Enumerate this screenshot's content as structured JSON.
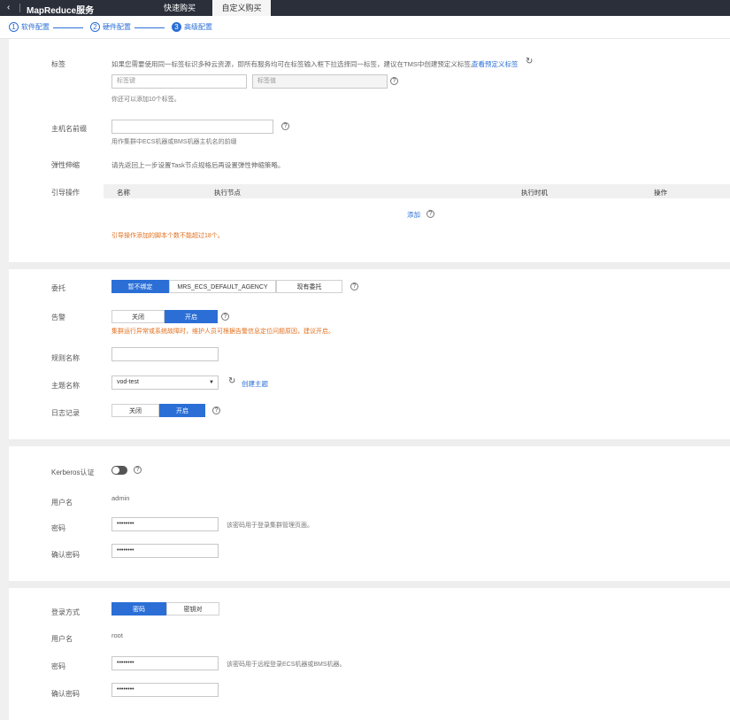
{
  "header": {
    "title": "MapReduce服务",
    "tabs": [
      "快速购买",
      "自定义购买"
    ]
  },
  "steps": [
    {
      "num": "1",
      "label": "软件配置"
    },
    {
      "num": "2",
      "label": "硬件配置"
    },
    {
      "num": "3",
      "label": "高级配置"
    }
  ],
  "tags": {
    "label": "标签",
    "hint": "如果您需要使用同一标签标识多种云资源，即所有服务均可在标签输入框下拉选择同一标签，建议在TMS中创建预定义标签。",
    "link": "查看预定义标签",
    "key_placeholder": "标签键",
    "value_placeholder": "标签值",
    "remaining": "你还可以添加10个标签。"
  },
  "hostname": {
    "label": "主机名前缀",
    "desc": "用作集群中ECS机器或BMS机器主机名的前缀"
  },
  "elastic": {
    "label": "弹性伸缩",
    "text": "请先返回上一步设置Task节点规格后再设置弹性伸缩策略。"
  },
  "bootstrap": {
    "label": "引导操作",
    "columns": [
      "名称",
      "执行节点",
      "执行时机",
      "操作"
    ],
    "add": "添加",
    "warn": "引导操作添加的脚本个数不能超过18个。"
  },
  "agency": {
    "label": "委托",
    "options": [
      "暂不绑定",
      "MRS_ECS_DEFAULT_AGENCY",
      "现有委托"
    ]
  },
  "alarm": {
    "label": "告警",
    "options": [
      "关闭",
      "开启"
    ],
    "warn": "集群运行异常或系统故障时，维护人员可根据告警信息定位问题原因，建议开启。"
  },
  "rule_name": {
    "label": "规则名称"
  },
  "topic": {
    "label": "主题名称",
    "value": "vod-test",
    "create": "创建主题"
  },
  "logging": {
    "label": "日志记录",
    "options": [
      "关闭",
      "开启"
    ]
  },
  "kerberos": {
    "label": "Kerberos认证",
    "user_label": "用户名",
    "user": "admin",
    "pwd_label": "密码",
    "pwd": "••••••••",
    "pwd_desc": "该密码用于登录集群管理页面。",
    "confirm_label": "确认密码",
    "confirm": "••••••••"
  },
  "login": {
    "label": "登录方式",
    "options": [
      "密码",
      "密钥对"
    ],
    "user_label": "用户名",
    "user": "root",
    "pwd_label": "密码",
    "pwd": "••••••••",
    "pwd_desc": "该密码用于远程登录ECS机器或BMS机器。",
    "confirm_label": "确认密码",
    "confirm": "••••••••"
  },
  "icons": {
    "back": "chevron-left-icon",
    "help": "help-circle-icon",
    "refresh": "refresh-icon"
  }
}
